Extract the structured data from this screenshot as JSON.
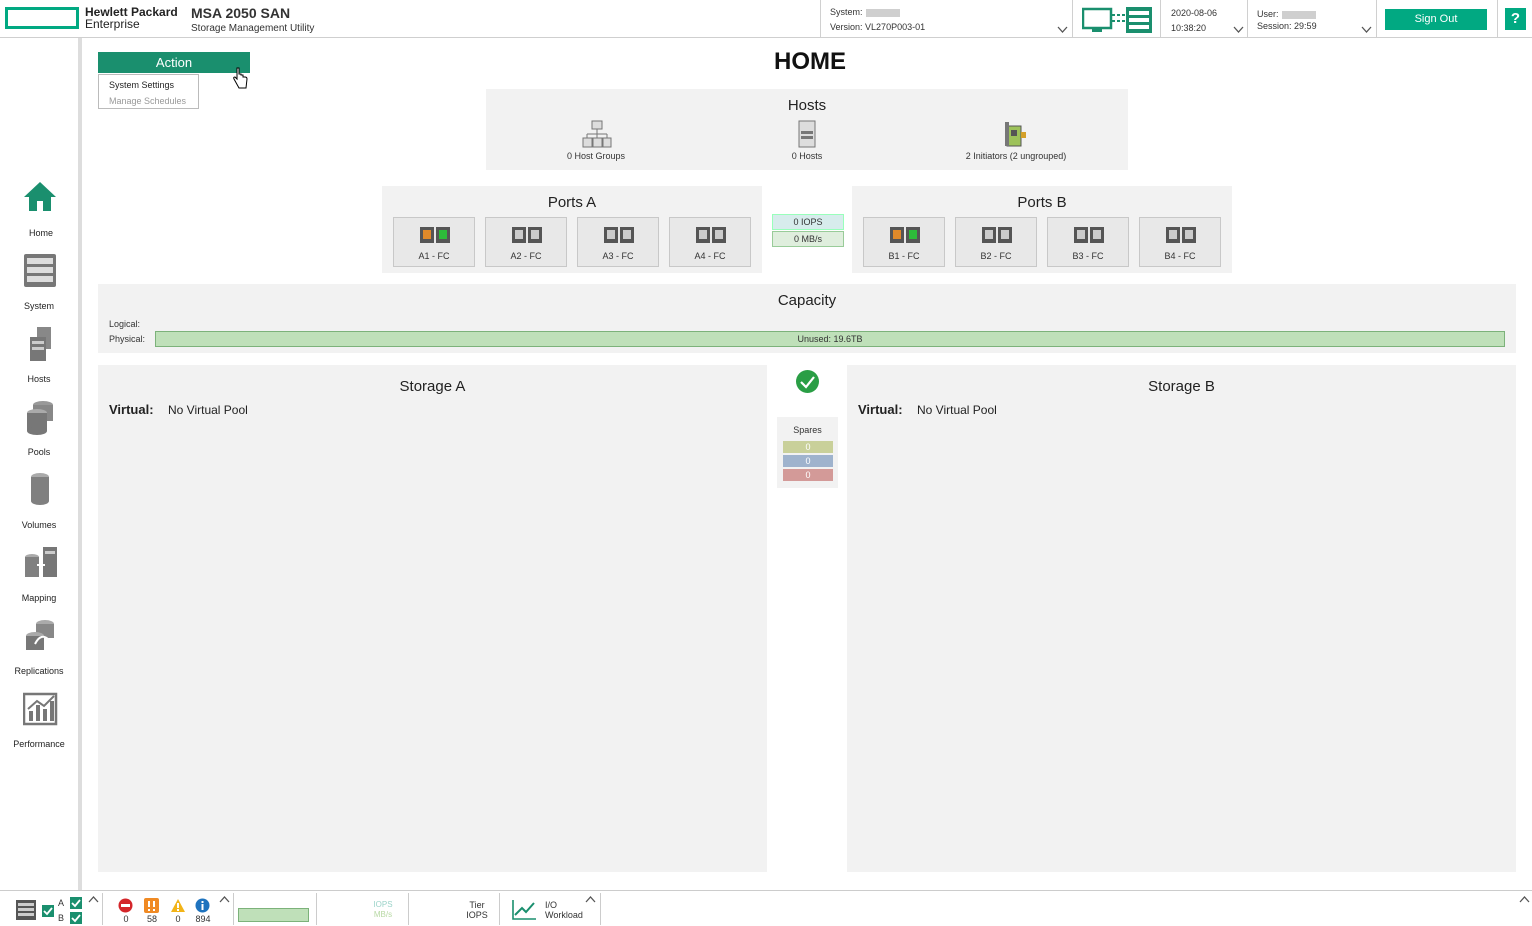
{
  "header": {
    "brand_line1": "Hewlett Packard",
    "brand_line2": "Enterprise",
    "product": "MSA 2050 SAN",
    "product_sub": "Storage Management Utility",
    "system_label": "System:",
    "version_label": "Version:",
    "version_value": "VL270P003-01",
    "date": "2020-08-06",
    "time": "10:38:20",
    "user_label": "User:",
    "session_label": "Session:",
    "session_value": "29:59",
    "sign_out": "Sign Out",
    "help": "?"
  },
  "colors": {
    "accent": "#01a982",
    "action": "#1a8f6e",
    "iops_bg": "#d7ecec",
    "mbs_bg": "#dfeedd",
    "spare1": "#c9d09a",
    "spare2": "#9fb3cd",
    "spare3": "#d39a98"
  },
  "sidebar": {
    "items": [
      {
        "label": "Home",
        "icon": "home-icon"
      },
      {
        "label": "System",
        "icon": "system-icon"
      },
      {
        "label": "Hosts",
        "icon": "hosts-icon"
      },
      {
        "label": "Pools",
        "icon": "pools-icon"
      },
      {
        "label": "Volumes",
        "icon": "volumes-icon"
      },
      {
        "label": "Mapping",
        "icon": "mapping-icon"
      },
      {
        "label": "Replications",
        "icon": "replications-icon"
      },
      {
        "label": "Performance",
        "icon": "performance-icon"
      }
    ]
  },
  "action": {
    "label": "Action",
    "menu": [
      {
        "label": "System Settings"
      },
      {
        "label": "Manage Schedules"
      }
    ]
  },
  "main": {
    "title": "HOME",
    "hosts": {
      "title": "Hosts",
      "host_groups": "0 Host Groups",
      "hosts": "0 Hosts",
      "initiators": "2 Initiators (2 ungrouped)"
    },
    "ports_a": {
      "title": "Ports A",
      "ports": [
        "A1 - FC",
        "A2 - FC",
        "A3 - FC",
        "A4 - FC"
      ]
    },
    "ports_b": {
      "title": "Ports B",
      "ports": [
        "B1 - FC",
        "B2 - FC",
        "B3 - FC",
        "B4 - FC"
      ]
    },
    "iops": "0 IOPS",
    "mbs": "0 MB/s",
    "capacity": {
      "title": "Capacity",
      "logical_label": "Logical:",
      "physical_label": "Physical:",
      "physical_value": "Unused: 19.6TB"
    },
    "storage_a": {
      "title": "Storage A",
      "virtual_label": "Virtual:",
      "virtual_value": "No Virtual Pool"
    },
    "storage_b": {
      "title": "Storage B",
      "virtual_label": "Virtual:",
      "virtual_value": "No Virtual Pool"
    },
    "spares": {
      "title": "Spares",
      "values": [
        "0",
        "0",
        "0"
      ]
    }
  },
  "footer": {
    "ctrl_a": "A",
    "ctrl_b": "B",
    "counts": {
      "critical": "0",
      "error": "58",
      "warning": "0",
      "info": "894"
    },
    "perf_iops": "IOPS",
    "perf_mbs": "MB/s",
    "tier": "Tier",
    "tier_iops": "IOPS",
    "io": "I/O",
    "workload": "Workload"
  }
}
